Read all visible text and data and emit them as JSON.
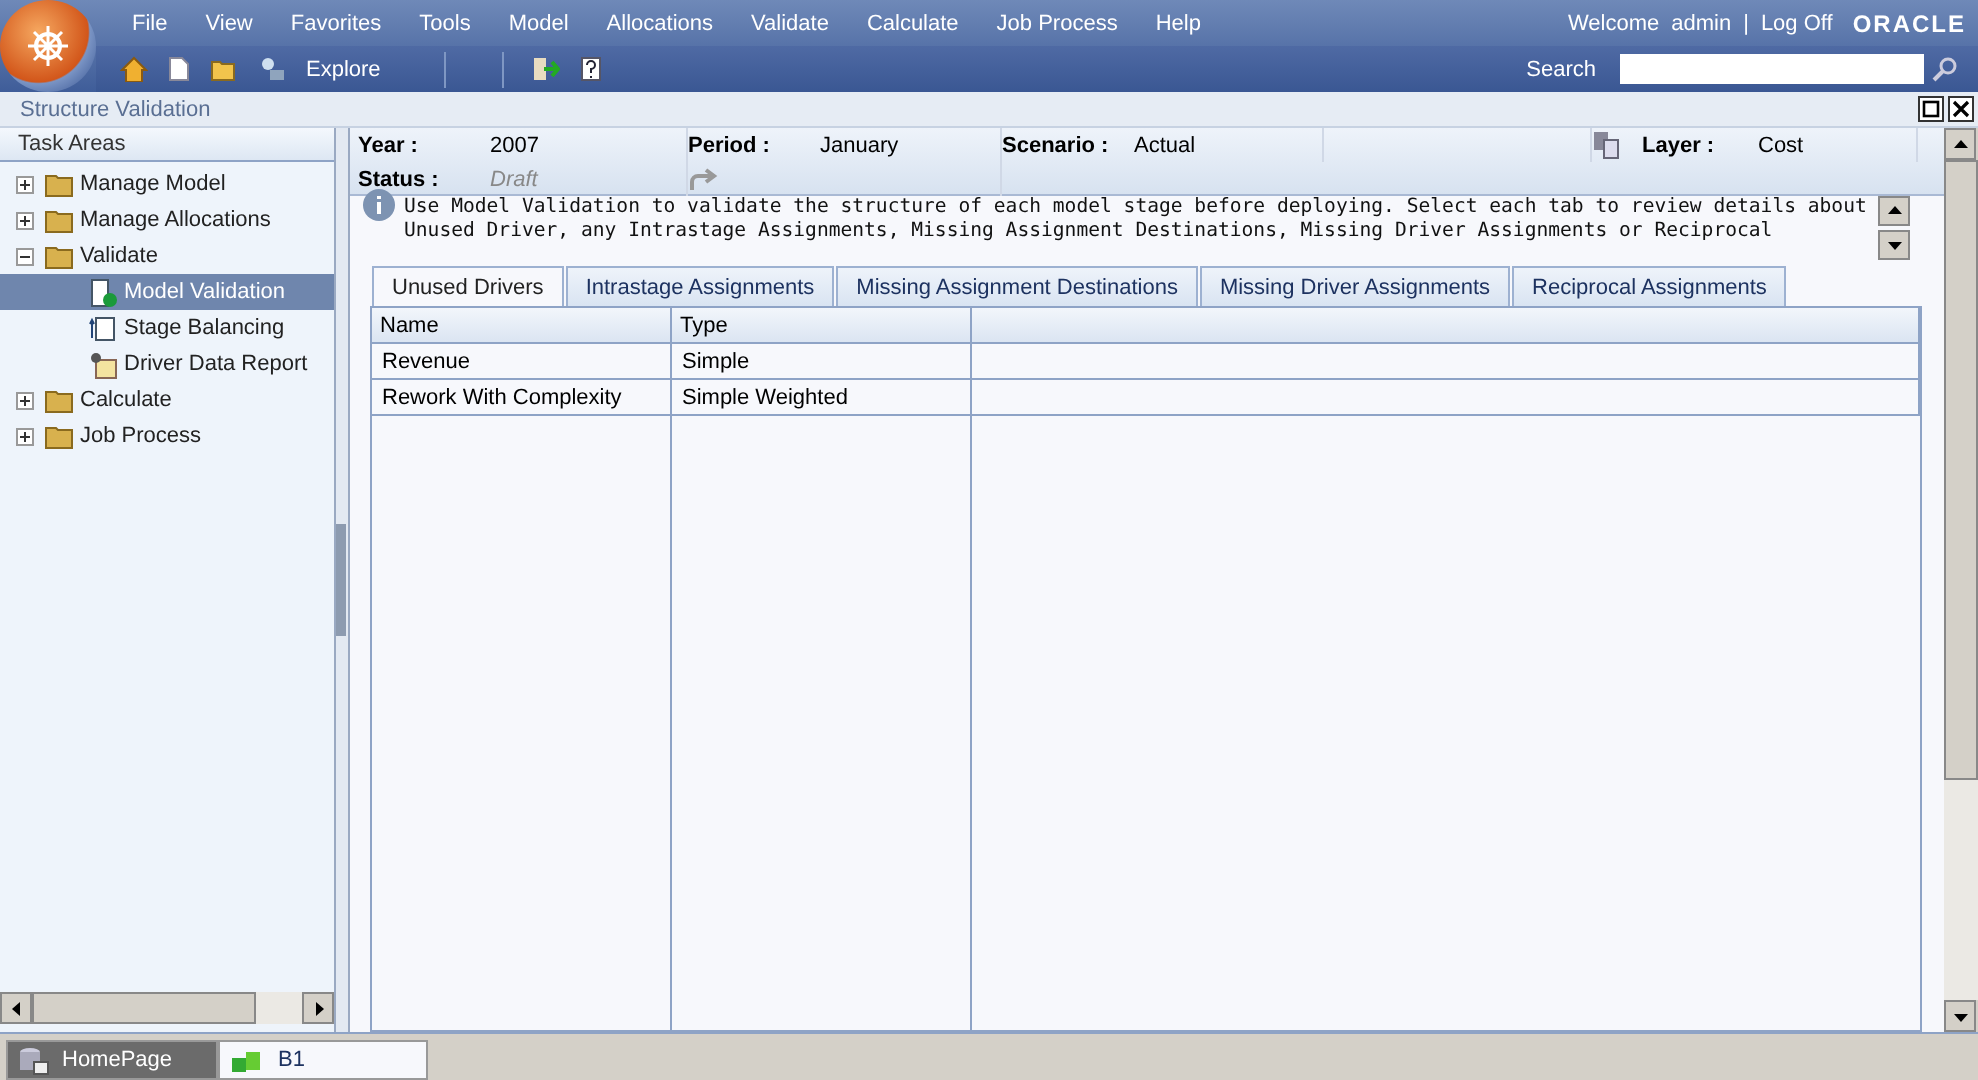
{
  "header": {
    "menu": [
      "File",
      "View",
      "Favorites",
      "Tools",
      "Model",
      "Allocations",
      "Validate",
      "Calculate",
      "Job Process",
      "Help"
    ],
    "welcome": "Welcome",
    "user": "admin",
    "separator": "|",
    "logoff": "Log Off",
    "brand": "ORACLE",
    "explore": "Explore",
    "search_label": "Search"
  },
  "panel_title": "Structure Validation",
  "task_areas": {
    "title": "Task Areas",
    "items": [
      {
        "label": "Manage Model",
        "kind": "folder",
        "expanded": false,
        "selected": false
      },
      {
        "label": "Manage Allocations",
        "kind": "folder",
        "expanded": false,
        "selected": false
      },
      {
        "label": "Validate",
        "kind": "folder",
        "expanded": true,
        "selected": false,
        "children": [
          {
            "label": "Model Validation",
            "kind": "validation",
            "selected": true
          },
          {
            "label": "Stage Balancing",
            "kind": "balancing",
            "selected": false
          },
          {
            "label": "Driver Data Report",
            "kind": "report",
            "selected": false
          }
        ]
      },
      {
        "label": "Calculate",
        "kind": "folder",
        "expanded": false,
        "selected": false
      },
      {
        "label": "Job Process",
        "kind": "folder",
        "expanded": false,
        "selected": false
      }
    ]
  },
  "pov": [
    {
      "label": "Year :",
      "value": "2007"
    },
    {
      "label": "Period :",
      "value": "January"
    },
    {
      "label": "Scenario :",
      "value": "Actual"
    },
    {
      "label": "Layer :",
      "value": "Cost"
    }
  ],
  "status": {
    "label": "Status :",
    "value": "Draft"
  },
  "info": [
    "Use Model Validation to validate the structure of each model stage before deploying. Select each tab to review details about",
    "Unused Driver, any Intrastage Assignments, Missing Assignment Destinations, Missing Driver Assignments or Reciprocal"
  ],
  "tabs": [
    {
      "label": "Unused Drivers",
      "selected": true
    },
    {
      "label": "Intrastage Assignments",
      "selected": false
    },
    {
      "label": "Missing Assignment Destinations",
      "selected": false
    },
    {
      "label": "Missing Driver Assignments",
      "selected": false
    },
    {
      "label": "Reciprocal Assignments",
      "selected": false
    }
  ],
  "table": {
    "columns": [
      "Name",
      "Type"
    ],
    "rows": [
      [
        "Revenue",
        "Simple"
      ],
      [
        "Rework With Complexity",
        "Simple Weighted"
      ]
    ]
  },
  "bottom_tabs": [
    {
      "label": "HomePage",
      "selected": false
    },
    {
      "label": "B1",
      "selected": true
    }
  ]
}
